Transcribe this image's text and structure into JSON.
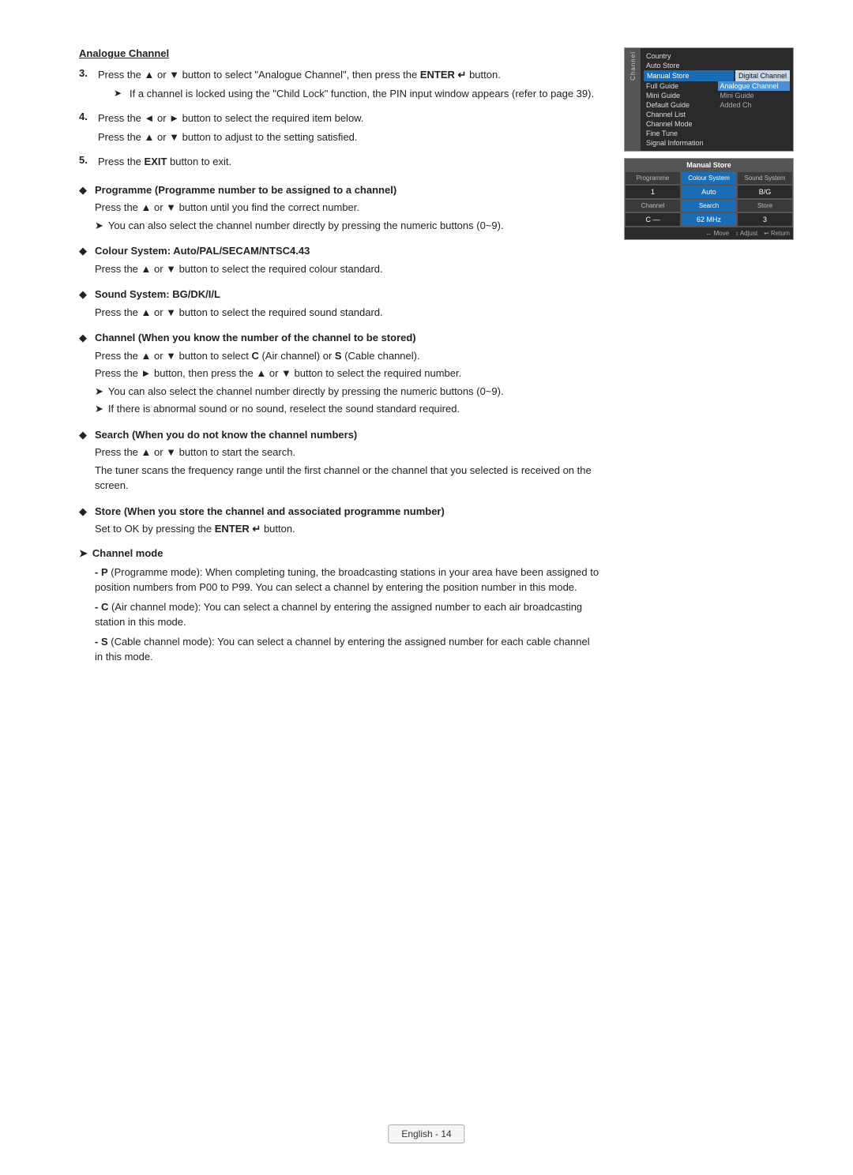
{
  "page": {
    "title": "Analogue Channel",
    "footer": "English - 14"
  },
  "steps": [
    {
      "num": "3.",
      "main": "Press the ▲ or ▼ button to select \"Analogue Channel\", then press the ENTER  button.",
      "enter_label": "ENTER",
      "subs": [
        "If a channel is locked using the \"Child Lock\" function, the PIN input window appears (refer to page 39)."
      ]
    },
    {
      "num": "4.",
      "lines": [
        "Press the ◄ or ► button to select the required item below.",
        "Press the ▲ or ▼ button to adjust to the setting satisfied."
      ]
    },
    {
      "num": "5.",
      "main": "Press the EXIT button to exit.",
      "exit_label": "EXIT"
    }
  ],
  "bullets": [
    {
      "title": "Programme (Programme number to be assigned to a channel)",
      "lines": [
        "Press the ▲ or ▼ button until you find the correct number."
      ],
      "subs": [
        "You can also select the channel number directly by pressing the numeric buttons (0~9)."
      ]
    },
    {
      "title": "Colour System: Auto/PAL/SECAM/NTSC4.43",
      "lines": [
        "Press the ▲ or ▼ button to select the required colour standard."
      ],
      "subs": []
    },
    {
      "title": "Sound System: BG/DK/I/L",
      "lines": [
        "Press the ▲ or ▼ button to select the required sound standard."
      ],
      "subs": []
    },
    {
      "title": "Channel (When you know the number of the channel to be stored)",
      "lines": [
        "Press the ▲ or ▼ button to select C (Air channel) or S (Cable channel).",
        "Press the ► button, then press the ▲ or ▼ button to select the required number."
      ],
      "subs": [
        "You can also select the channel number directly by pressing the numeric buttons (0~9).",
        "If there is abnormal sound or no sound, reselect the sound standard required."
      ]
    },
    {
      "title": "Search (When you do not know the channel numbers)",
      "lines": [
        "Press the ▲ or ▼ button to start the search.",
        "The tuner scans the frequency range until the first channel or the channel that you selected is received on the screen."
      ],
      "subs": []
    },
    {
      "title": "Store (When you store the channel and associated programme number)",
      "lines": [
        "Set to OK by pressing the ENTER  button."
      ],
      "subs": []
    }
  ],
  "channel_mode": {
    "title": "Channel mode",
    "items": [
      "- P (Programme mode): When completing tuning, the broadcasting stations in your area have been assigned to position numbers from P00 to P99. You can select a channel by entering the position number in this mode.",
      "- C (Air channel mode): You can select a channel by entering the assigned number to each air broadcasting station in this mode.",
      "- S (Cable channel mode): You can select a channel by entering the assigned number for each cable channel in this mode."
    ]
  },
  "tv_panel": {
    "channel_label": "Channel",
    "items_col1": [
      "Country",
      "Auto Store",
      "Manual Store",
      "Full Guide",
      "Mini Guide",
      "Default Guide",
      "Channel List",
      "Channel Mode",
      "Fine Tune",
      "Signal Information"
    ],
    "items_col2": [
      "Digital Channel",
      "Analogue Channel",
      "Mini Guide",
      "Added Ch"
    ],
    "highlighted_col1": "Manual Store",
    "highlighted_col2": "Digital Channel",
    "selected_col2": "Analogue Channel"
  },
  "manual_store": {
    "header": "Manual Store",
    "col_headers": [
      "Programme",
      "Colour System",
      "Sound System"
    ],
    "row1_values": [
      "1",
      "Auto",
      "B/G"
    ],
    "col_headers2": [
      "Channel",
      "Search",
      "Store"
    ],
    "row2_values": [
      "C  —",
      "62 MHz",
      "3"
    ],
    "footer": [
      "↔ Move",
      "↕ Adjust",
      "↩ Return"
    ]
  }
}
